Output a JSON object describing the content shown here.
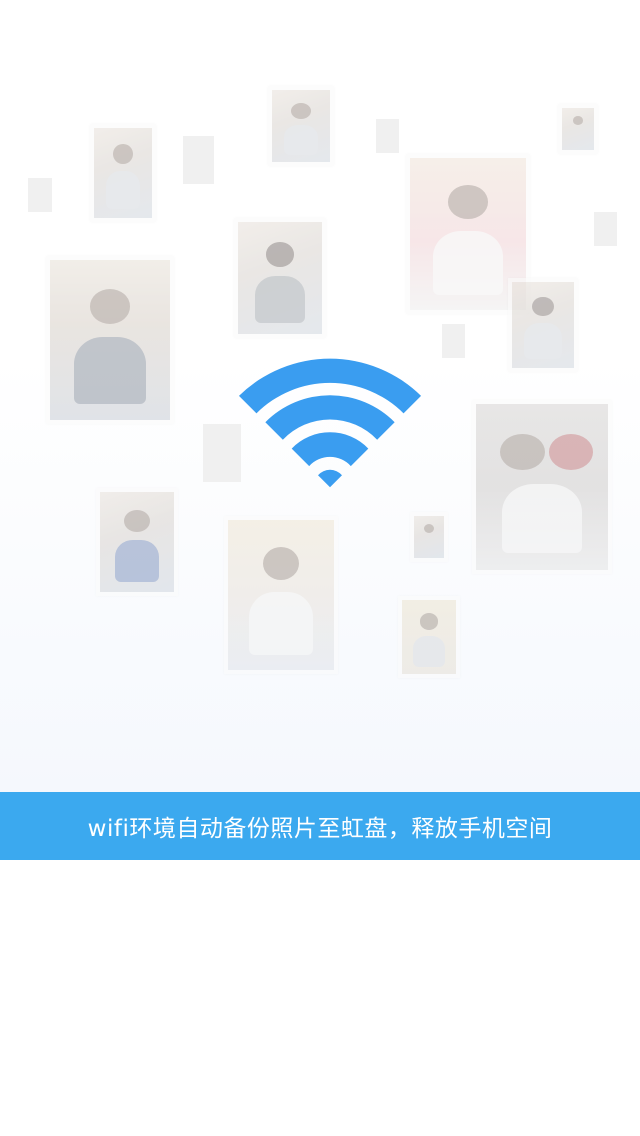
{
  "screen": {
    "caption": "wifi环境自动备份照片至虹盘，释放手机空间"
  },
  "icons": {
    "wifi": "wifi-icon"
  },
  "colors": {
    "accent": "#3ba9ef",
    "wifi": "#3a9df0",
    "caption_text": "#ffffff",
    "placeholder_tile": "#ececec"
  }
}
